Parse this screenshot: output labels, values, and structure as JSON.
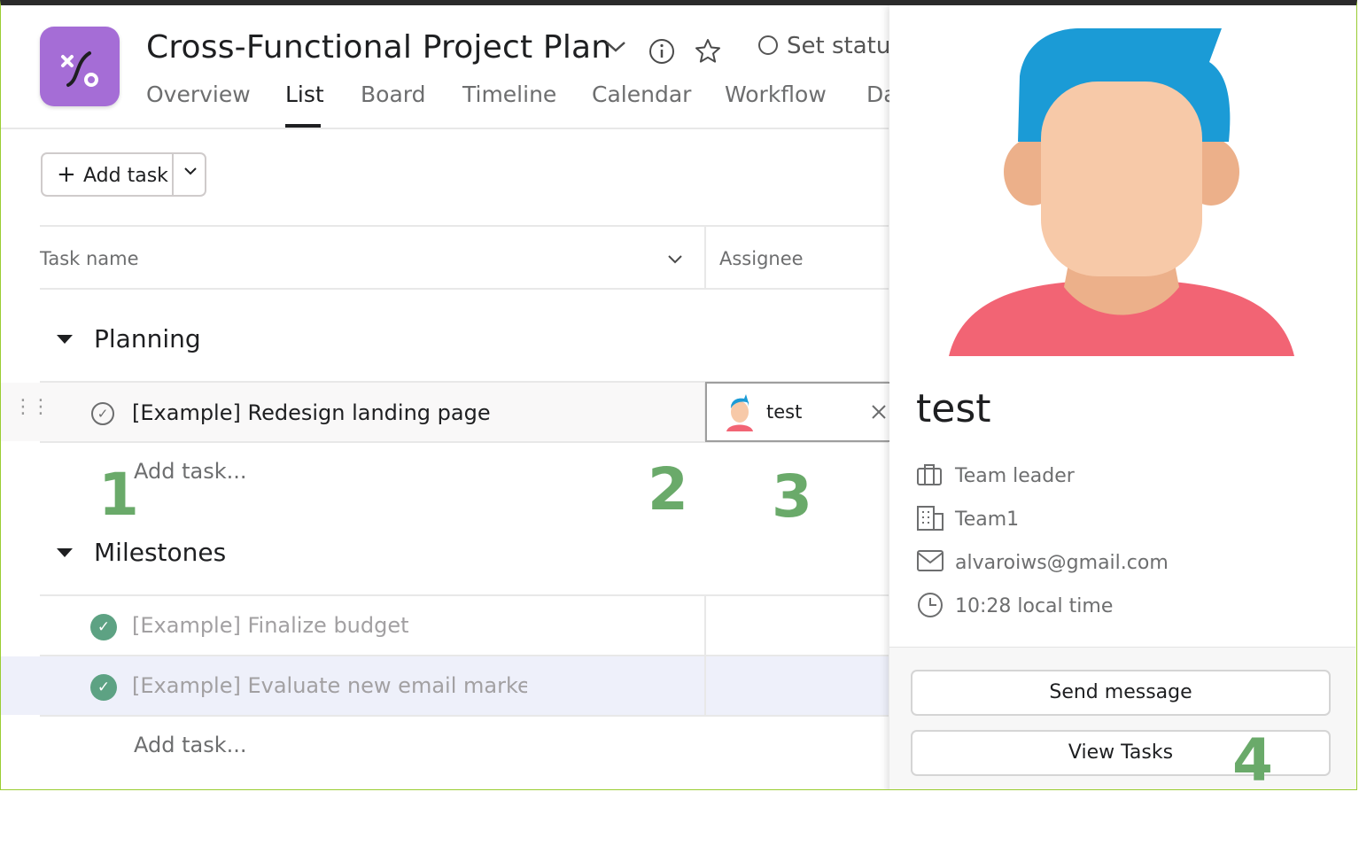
{
  "header": {
    "title": "Cross-Functional Project Plan",
    "set_status": "Set status"
  },
  "tabs": [
    "Overview",
    "List",
    "Board",
    "Timeline",
    "Calendar",
    "Workflow",
    "Da"
  ],
  "active_tab": "List",
  "toolbar": {
    "add_task": "Add task"
  },
  "columns": {
    "task_name": "Task name",
    "assignee": "Assignee"
  },
  "sections": [
    {
      "title": "Planning",
      "tasks": [
        {
          "name": "[Example] Redesign landing page",
          "completed": false,
          "assignee": "test"
        }
      ],
      "add_task": "Add task..."
    },
    {
      "title": "Milestones",
      "tasks": [
        {
          "name": "[Example] Finalize budget",
          "completed": true
        },
        {
          "name": "[Example] Evaluate new email marketin",
          "completed": true
        }
      ],
      "add_task": "Add task..."
    }
  ],
  "annotations": [
    "1",
    "2",
    "3",
    "4"
  ],
  "profile_card": {
    "name": "test",
    "role": "Team leader",
    "team": "Team1",
    "email": "alvaroiws@gmail.com",
    "local_time": "10:28 local time",
    "send_message": "Send message",
    "view_tasks": "View Tasks"
  },
  "colors": {
    "app_icon": "#a56dd6",
    "completed_check": "#5da283",
    "annotation": "#6aaa6a",
    "avatar_hair": "#1b9bd6",
    "avatar_shirt": "#f26474",
    "avatar_skin": "#f7c9a8"
  }
}
